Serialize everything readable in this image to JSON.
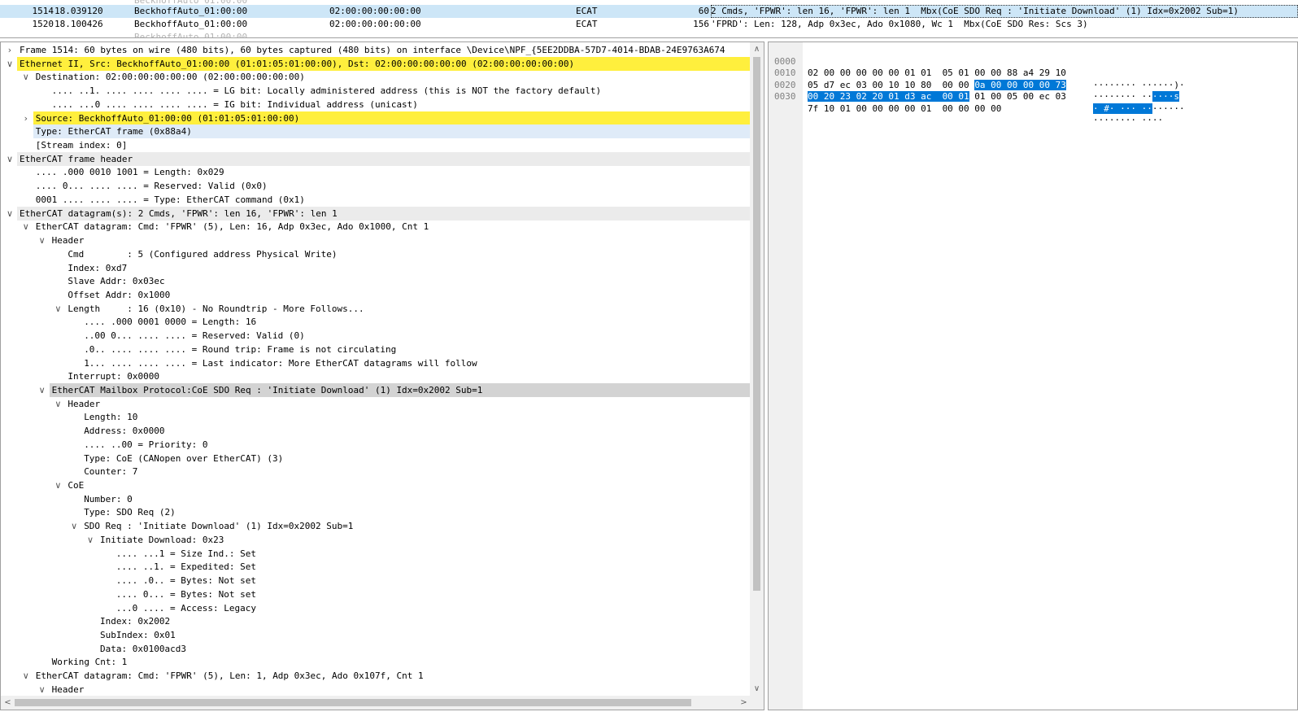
{
  "packet_list": {
    "rows": [
      {
        "no": "1514",
        "time": "18.039120",
        "src": "BeckhoffAuto_01:00:00",
        "dst": "02:00:00:00:00:00",
        "proto": "ECAT",
        "len": "60",
        "info": "2 Cmds, 'FPWR': len 16, 'FPWR': len 1  Mbx(CoE SDO Req : 'Initiate Download' (1) Idx=0x2002 Sub=1)"
      },
      {
        "no": "1520",
        "time": "18.100426",
        "src": "BeckhoffAuto_01:00:00",
        "dst": "02:00:00:00:00:00",
        "proto": "ECAT",
        "len": "156",
        "info": "'FPRD': Len: 128, Adp 0x3ec, Ado 0x1080, Wc 1  Mbx(CoE SDO Res: Scs 3)"
      }
    ]
  },
  "details": {
    "rows": [
      {
        "t": "Frame 1514: 60 bytes on wire (480 bits), 60 bytes captured (480 bits) on interface \\Device\\NPF_{5EE2DDBA-57D7-4014-BDAB-24E9763A674"
      },
      {
        "t": "Ethernet II, Src: BeckhoffAuto_01:00:00 (01:01:05:01:00:00), Dst: 02:00:00:00:00:00 (02:00:00:00:00:00)"
      },
      {
        "t": "Destination: 02:00:00:00:00:00 (02:00:00:00:00:00)"
      },
      {
        "t": ".... ..1. .... .... .... .... = LG bit: Locally administered address (this is NOT the factory default)"
      },
      {
        "t": ".... ...0 .... .... .... .... = IG bit: Individual address (unicast)"
      },
      {
        "t": "Source: BeckhoffAuto_01:00:00 (01:01:05:01:00:00)"
      },
      {
        "t": "Type: EtherCAT frame (0x88a4)"
      },
      {
        "t": "[Stream index: 0]"
      },
      {
        "t": "EtherCAT frame header"
      },
      {
        "t": ".... .000 0010 1001 = Length: 0x029"
      },
      {
        "t": ".... 0... .... .... = Reserved: Valid (0x0)"
      },
      {
        "t": "0001 .... .... .... = Type: EtherCAT command (0x1)"
      },
      {
        "t": "EtherCAT datagram(s): 2 Cmds, 'FPWR': len 16, 'FPWR': len 1"
      },
      {
        "t": "EtherCAT datagram: Cmd: 'FPWR' (5), Len: 16, Adp 0x3ec, Ado 0x1000, Cnt 1"
      },
      {
        "t": "Header"
      },
      {
        "t": "Cmd        : 5 (Configured address Physical Write)"
      },
      {
        "t": "Index: 0xd7"
      },
      {
        "t": "Slave Addr: 0x03ec"
      },
      {
        "t": "Offset Addr: 0x1000"
      },
      {
        "t": "Length     : 16 (0x10) - No Roundtrip - More Follows..."
      },
      {
        "t": ".... .000 0001 0000 = Length: 16"
      },
      {
        "t": "..00 0... .... .... = Reserved: Valid (0)"
      },
      {
        "t": ".0.. .... .... .... = Round trip: Frame is not circulating"
      },
      {
        "t": "1... .... .... .... = Last indicator: More EtherCAT datagrams will follow"
      },
      {
        "t": "Interrupt: 0x0000"
      },
      {
        "t": "EtherCAT Mailbox Protocol:CoE SDO Req : 'Initiate Download' (1) Idx=0x2002 Sub=1"
      },
      {
        "t": "Header"
      },
      {
        "t": "Length: 10"
      },
      {
        "t": "Address: 0x0000"
      },
      {
        "t": ".... ..00 = Priority: 0"
      },
      {
        "t": "Type: CoE (CANopen over EtherCAT) (3)"
      },
      {
        "t": "Counter: 7"
      },
      {
        "t": "CoE"
      },
      {
        "t": "Number: 0"
      },
      {
        "t": "Type: SDO Req (2)"
      },
      {
        "t": "SDO Req : 'Initiate Download' (1) Idx=0x2002 Sub=1"
      },
      {
        "t": "Initiate Download: 0x23"
      },
      {
        "t": ".... ...1 = Size Ind.: Set"
      },
      {
        "t": ".... ..1. = Expedited: Set"
      },
      {
        "t": ".... .0.. = Bytes: Not set"
      },
      {
        "t": ".... 0... = Bytes: Not set"
      },
      {
        "t": "...0 .... = Access: Legacy"
      },
      {
        "t": "Index: 0x2002"
      },
      {
        "t": "SubIndex: 0x01"
      },
      {
        "t": "Data: 0x0100acd3"
      },
      {
        "t": "Working Cnt: 1"
      },
      {
        "t": "EtherCAT datagram: Cmd: 'FPWR' (5), Len: 1, Adp 0x3ec, Ado 0x107f, Cnt 1"
      },
      {
        "t": "Header"
      }
    ]
  },
  "bytes": {
    "lines": [
      {
        "off": "0000",
        "hex": [
          "02 00 00 00 00 00 01 01  05 01 00 00 88 a4 29 10"
        ],
        "ascii": [
          "········ ······)·"
        ]
      },
      {
        "off": "0010",
        "hex": [
          "05 d7 ec 03 00 10 10 80  00 00 ",
          "0a 00 00 00 00 73"
        ],
        "ascii": [
          "········ ··",
          "····s"
        ]
      },
      {
        "off": "0020",
        "hex": [
          "00 20 23 02 20 01 d3 ac  00 01",
          " 01 00 05 00 ec 03"
        ],
        "ascii": [
          "· #· ··· ··",
          "······"
        ]
      },
      {
        "off": "0030",
        "hex": [
          "7f 10 01 00 00 00 00 01  00 00 00 00"
        ],
        "ascii": [
          "········ ····"
        ]
      }
    ]
  },
  "scroll": {
    "up": "∧",
    "down": "∨",
    "left": "<",
    "right": ">"
  },
  "colors": {
    "selected_row": "#cde6f7",
    "highlight_yellow": "#ffef3d",
    "byte_selection": "#0078d7"
  }
}
